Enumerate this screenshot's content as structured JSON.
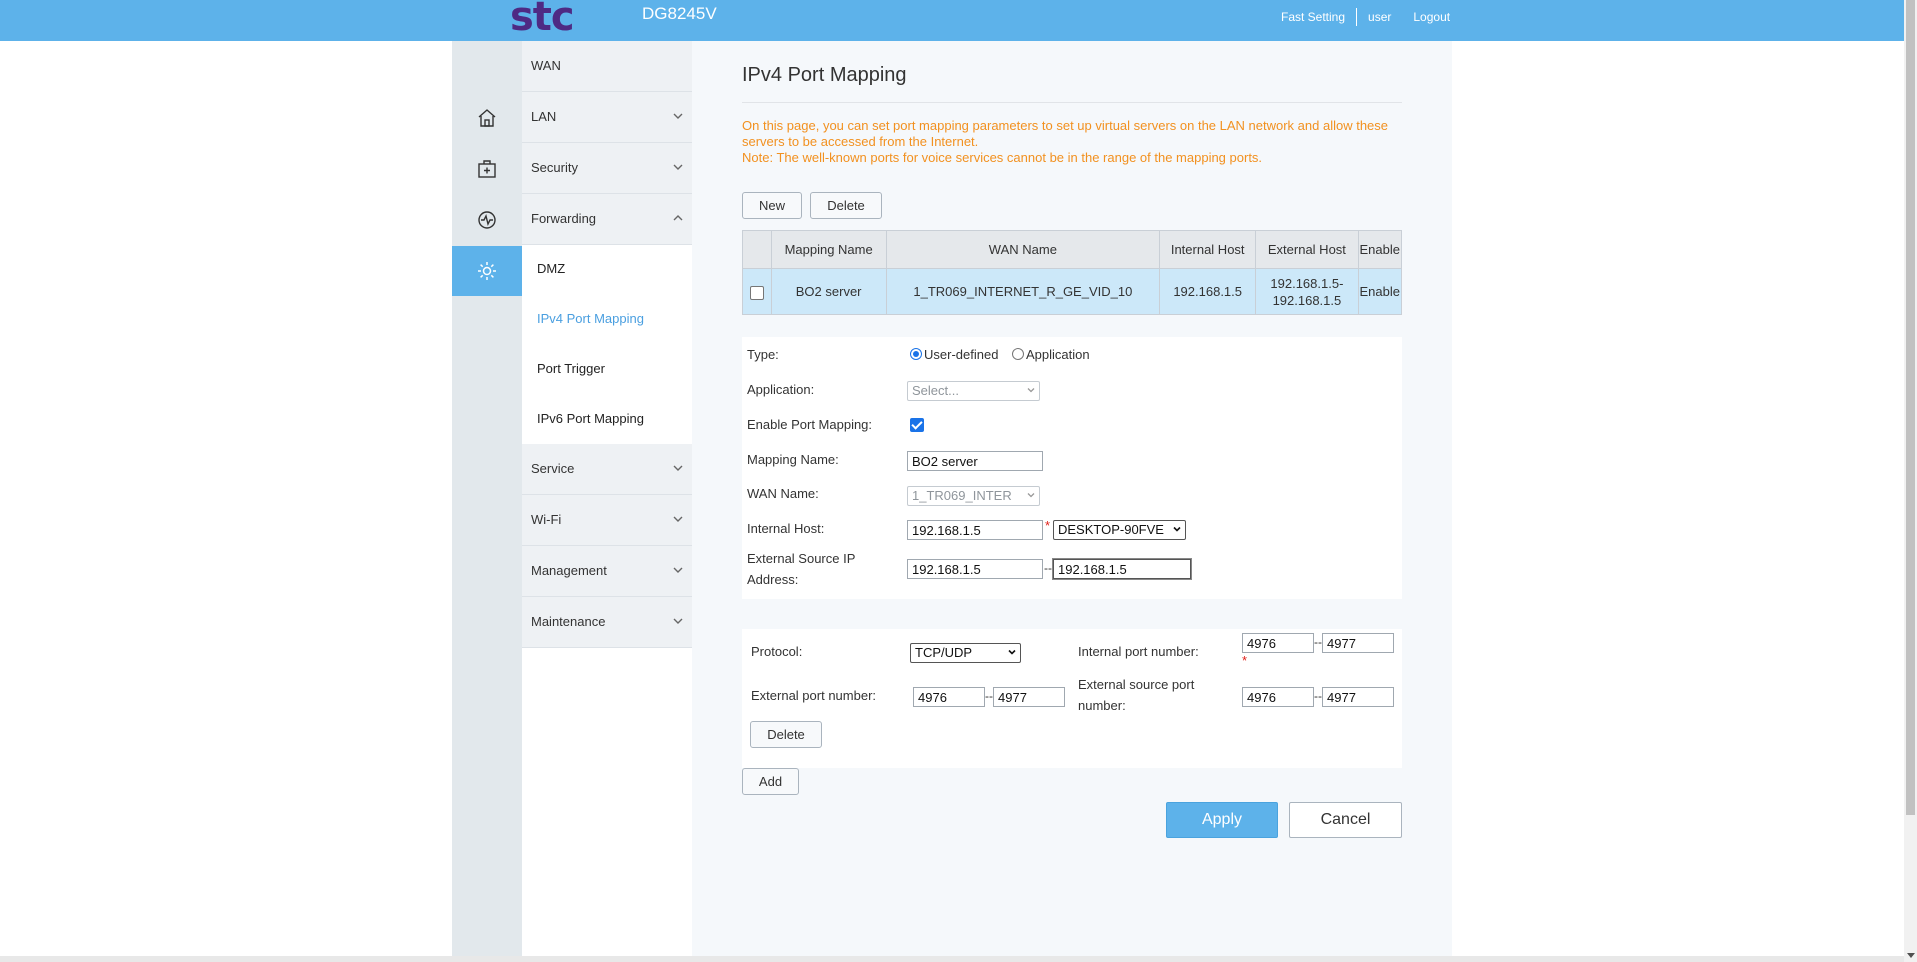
{
  "header": {
    "logo_text": "stc",
    "model": "DG8245V",
    "links": [
      "Fast Setting",
      "user",
      "Logout"
    ]
  },
  "nav": {
    "groups": [
      "WAN",
      "LAN",
      "Security",
      "Forwarding",
      "Service",
      "Wi-Fi",
      "Management",
      "Maintenance"
    ],
    "forwarding_items": [
      "DMZ",
      "IPv4 Port Mapping",
      "Port Trigger",
      "IPv6 Port Mapping"
    ],
    "icons": [
      "home-icon",
      "medical-kit-icon",
      "activity-icon",
      "gear-icon"
    ]
  },
  "page": {
    "title": "IPv4 Port Mapping",
    "notice_line1": "On this page, you can set port mapping parameters to set up virtual servers on the LAN network and allow these servers to be accessed from the Internet.",
    "notice_line2": "Note: The well-known ports for voice services cannot be in the range of the mapping ports.",
    "new_label": "New",
    "delete_label": "Delete"
  },
  "table": {
    "headers": [
      "Mapping Name",
      "WAN Name",
      "Internal Host",
      "External Host",
      "Enable"
    ],
    "row": {
      "mapping_name": "BO2 server",
      "wan_name": "1_TR069_INTERNET_R_GE_VID_10",
      "internal_host": "192.168.1.5",
      "external_host_line1": "192.168.1.5-",
      "external_host_line2": "192.168.1.5",
      "enable": "Enable"
    }
  },
  "form": {
    "type_label": "Type:",
    "type_user_defined": "User-defined",
    "type_application": "Application",
    "application_label": "Application:",
    "application_value": "Select...",
    "enable_label": "Enable Port Mapping:",
    "mapping_name_label": "Mapping Name:",
    "mapping_name_value": "BO2 server",
    "wan_name_label": "WAN Name:",
    "wan_name_value": "1_TR069_INTER",
    "internal_host_label": "Internal Host:",
    "internal_host_value": "192.168.1.5",
    "internal_host_device": "DESKTOP-90FVE",
    "ext_src_ip_label_1": "External Source IP",
    "ext_src_ip_label_2": "Address:",
    "ext_src_ip_start": "192.168.1.5",
    "ext_src_ip_end": "192.168.1.5",
    "required_mark": "*",
    "range_dash": "--"
  },
  "ports": {
    "protocol_label": "Protocol:",
    "protocol_value": "TCP/UDP",
    "internal_port_label": "Internal port number:",
    "internal_port_start": "4976",
    "internal_port_end": "4977",
    "external_port_label": "External port number:",
    "external_port_start": "4976",
    "external_port_end": "4977",
    "external_src_port_label_1": "External source port",
    "external_src_port_label_2": "number:",
    "external_src_port_start": "4976",
    "external_src_port_end": "4977",
    "delete_label": "Delete",
    "add_label": "Add"
  },
  "actions": {
    "apply_label": "Apply",
    "cancel_label": "Cancel"
  },
  "colors": {
    "header_blue": "#5db2ea",
    "notice_orange": "#f29120",
    "active_link": "#4a9fe0",
    "brand_purple": "#4e2a84"
  }
}
